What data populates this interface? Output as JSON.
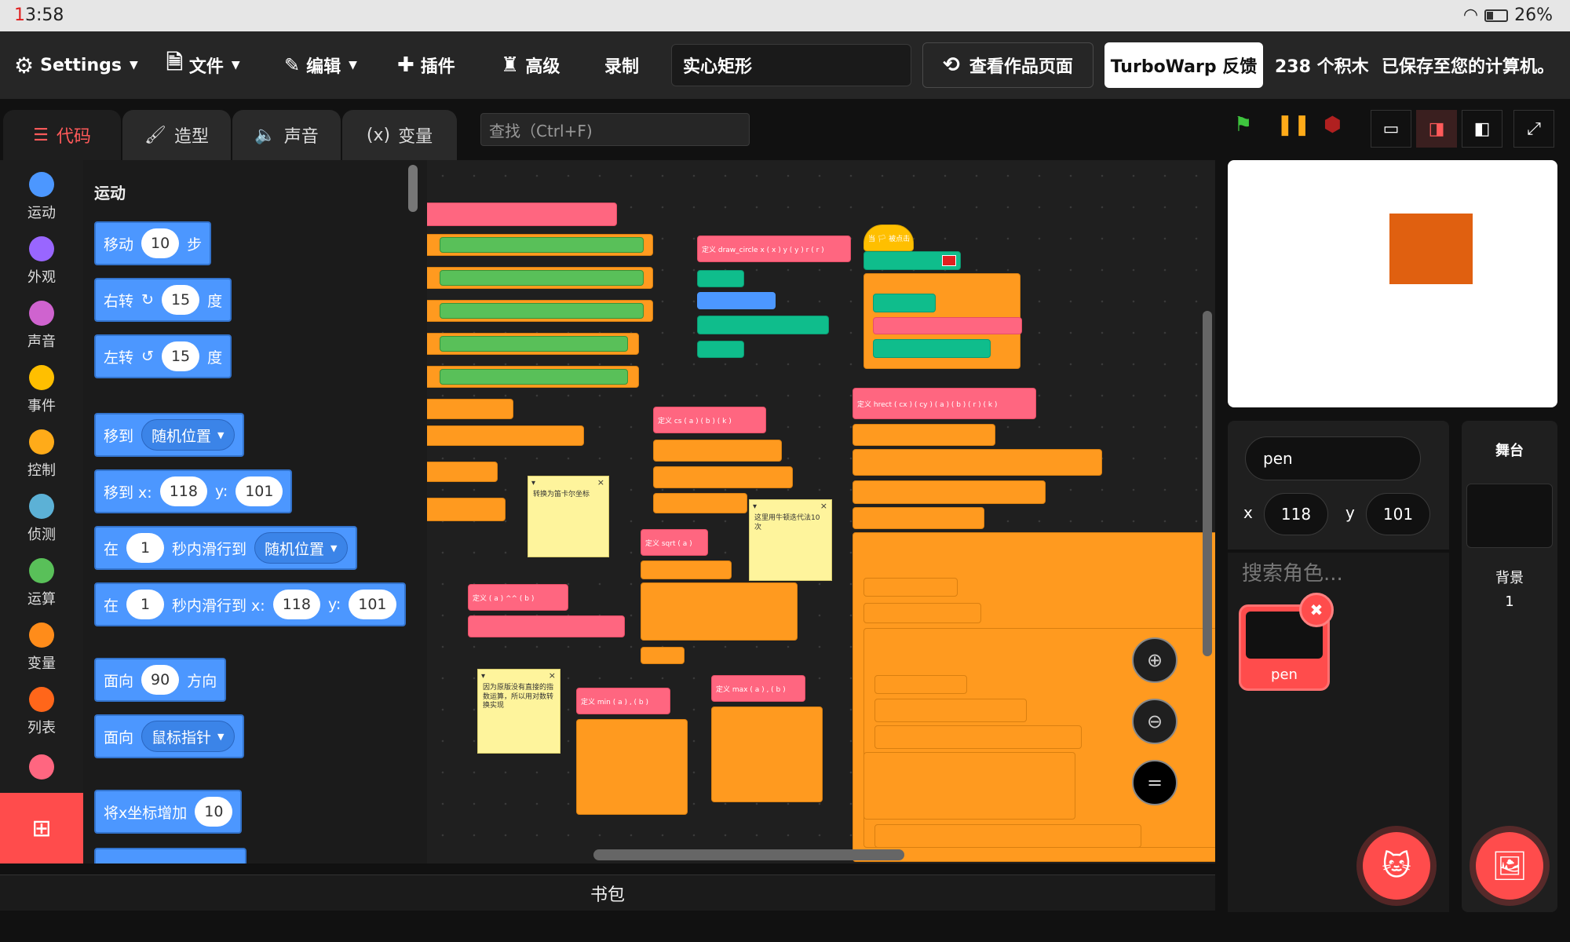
{
  "status": {
    "time_prefix": "1",
    "time": "3:58",
    "battery": "26%"
  },
  "menu": {
    "settings": "Settings",
    "file": "文件",
    "edit": "编辑",
    "addons": "插件",
    "advanced": "高级",
    "record": "录制",
    "project_title": "实心矩形",
    "see_page": "查看作品页面",
    "feedback": "TurboWarp 反馈",
    "block_count": "238 个积木",
    "saved": "已保存至您的计算机。"
  },
  "tabs": {
    "code": "代码",
    "costumes": "造型",
    "sounds": "声音",
    "variables": "变量"
  },
  "find_placeholder": "查找（Ctrl+F)",
  "categories": [
    {
      "label": "运动",
      "color": "#4c97ff"
    },
    {
      "label": "外观",
      "color": "#9966ff"
    },
    {
      "label": "声音",
      "color": "#cf63cf"
    },
    {
      "label": "事件",
      "color": "#ffbf00"
    },
    {
      "label": "控制",
      "color": "#ffab19"
    },
    {
      "label": "侦测",
      "color": "#5cb1d6"
    },
    {
      "label": "运算",
      "color": "#59c059"
    },
    {
      "label": "变量",
      "color": "#ff8c1a"
    },
    {
      "label": "列表",
      "color": "#ff661a"
    }
  ],
  "palette": {
    "title": "运动",
    "move": {
      "a": "移动",
      "n": "10",
      "b": "步"
    },
    "turn_right": {
      "a": "右转",
      "n": "15",
      "b": "度"
    },
    "turn_left": {
      "a": "左转",
      "n": "15",
      "b": "度"
    },
    "goto": {
      "a": "移到",
      "opt": "随机位置"
    },
    "goto_xy": {
      "a": "移到 x:",
      "x": "118",
      "y_label": "y:",
      "y": "101"
    },
    "glide": {
      "a": "在",
      "n": "1",
      "b": "秒内滑行到",
      "opt": "随机位置"
    },
    "glide_xy": {
      "a": "在",
      "n": "1",
      "b": "秒内滑行到 x:",
      "x": "118",
      "y_label": "y:",
      "y": "101"
    },
    "point_dir": {
      "a": "面向",
      "n": "90",
      "b": "方向"
    },
    "point_to": {
      "a": "面向",
      "opt": "鼠标指针"
    },
    "change_x": {
      "a": "将x坐标增加",
      "n": "10"
    }
  },
  "workspace": {
    "note1": "转换为笛卡尔坐标",
    "note2": "这里用牛顿迭代法10次",
    "note3": "因为原版没有直接的指数运算，所以用对数转换实现",
    "def_draw_circle": "定义 draw_circle x ( x ) y ( y ) r ( r )",
    "def_cs": "定义 cs ( a ) ( b ) ( k )",
    "def_sqrt": "定义 sqrt ( a )",
    "def_pow": "定义 ( a ) ^^ ( b )",
    "def_min": "定义 min ( a ) , ( b )",
    "def_max": "定义 max ( a ) , ( b )",
    "def_hrect": "定义 hrect ( cx ) ( cy ) ( a ) ( b ) ( r ) ( k )",
    "when_flag": "当 🏳 被点击"
  },
  "backpack": "书包",
  "sprite": {
    "name": "pen",
    "x_label": "x",
    "x": "118",
    "y_label": "y",
    "y": "101",
    "search": "搜索角色...",
    "card_name": "pen"
  },
  "stage_panel": {
    "title": "舞台",
    "backdrop_label": "背景",
    "backdrop_count": "1"
  },
  "colors": {
    "accent": "#ff4c4c",
    "motion": "#4c97ff",
    "stage_sprite": "#e06010"
  }
}
